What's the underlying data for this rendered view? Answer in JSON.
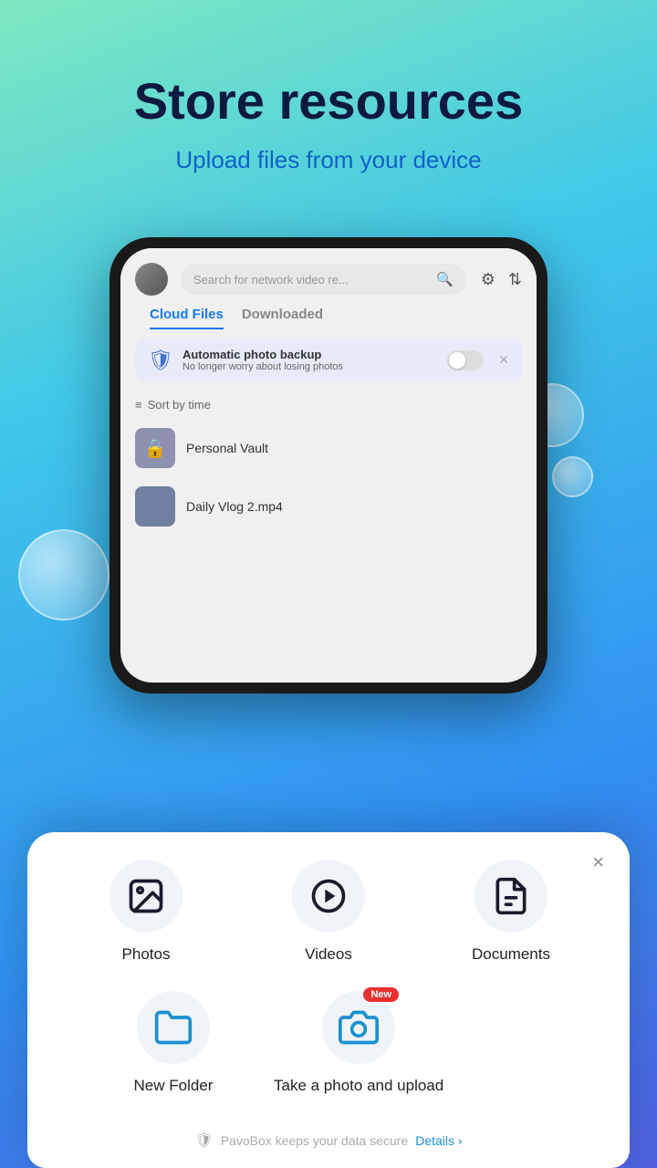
{
  "hero": {
    "title": "Store resources",
    "subtitle": "Upload files from your device"
  },
  "phone": {
    "search_placeholder": "Search for network video re...",
    "tabs": [
      {
        "label": "Cloud Files",
        "active": true
      },
      {
        "label": "Downloaded",
        "active": false
      }
    ],
    "backup": {
      "title": "Automatic photo backup",
      "desc": "No longer worry about losing photos"
    },
    "sort_label": "Sort by time",
    "files": [
      {
        "name": "Personal Vault"
      },
      {
        "name": "Daily Vlog 2.mp4"
      }
    ]
  },
  "modal": {
    "close_label": "×",
    "items": [
      {
        "id": "photos",
        "label": "Photos",
        "badge": ""
      },
      {
        "id": "videos",
        "label": "Videos",
        "badge": ""
      },
      {
        "id": "documents",
        "label": "Documents",
        "badge": ""
      },
      {
        "id": "new-folder",
        "label": "New Folder",
        "badge": ""
      },
      {
        "id": "take-photo",
        "label": "Take a photo and upload",
        "badge": "New"
      }
    ],
    "security_text": "PavoBox keeps your data secure",
    "details_label": "Details",
    "details_chevron": "›"
  }
}
